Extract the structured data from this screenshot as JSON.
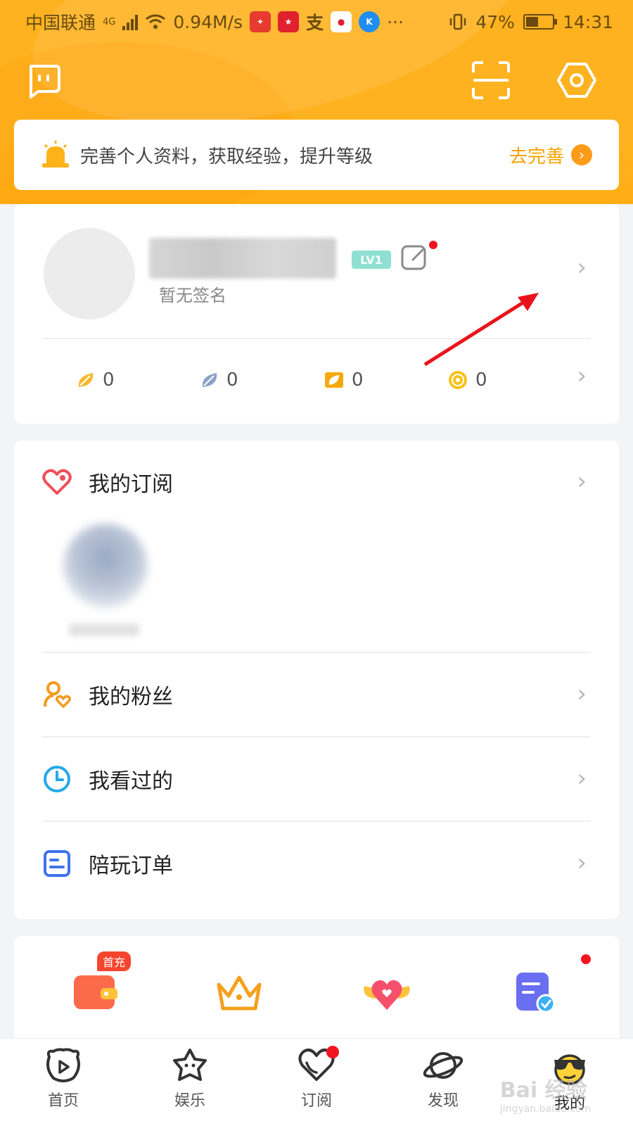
{
  "status_bar": {
    "carrier": "中国联通",
    "network": "4G",
    "speed": "0.94M/s",
    "battery": "47%",
    "battery_level": 0.47,
    "time": "14:31"
  },
  "notice": {
    "text": "完善个人资料，获取经验，提升等级",
    "action": "去完善"
  },
  "profile": {
    "level": "LV1",
    "signature": "暂无签名",
    "stats": [
      {
        "icon": "leaf-gold-icon",
        "value": "0"
      },
      {
        "icon": "leaf-blue-icon",
        "value": "0"
      },
      {
        "icon": "ticket-icon",
        "value": "0"
      },
      {
        "icon": "coin-icon",
        "value": "0"
      }
    ]
  },
  "menu": {
    "subscribe": "我的订阅",
    "fans": "我的粉丝",
    "history": "我看过的",
    "orders": "陪玩订单"
  },
  "promo": {
    "badge": "首充"
  },
  "tabs": [
    {
      "label": "首页"
    },
    {
      "label": "娱乐"
    },
    {
      "label": "订阅"
    },
    {
      "label": "发现"
    },
    {
      "label": "我的"
    }
  ],
  "watermark": {
    "brand": "Bai 经验",
    "url": "jingyan.baidu.com"
  }
}
